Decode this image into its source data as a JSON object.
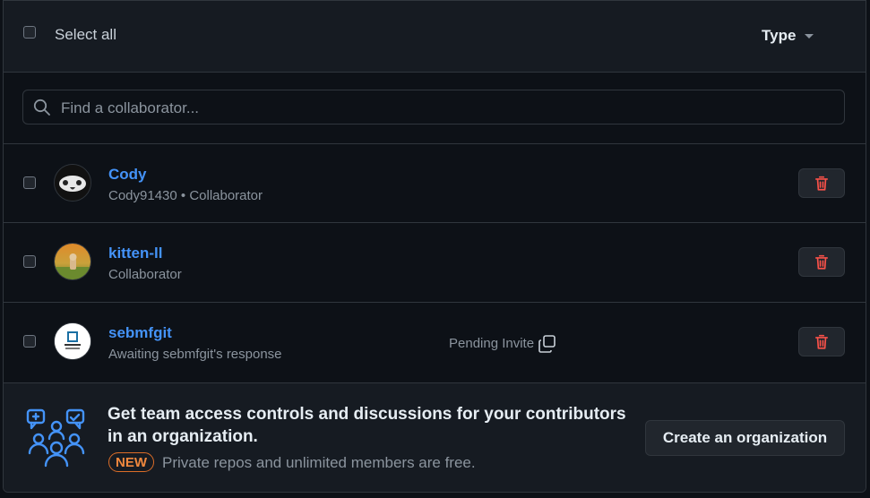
{
  "header": {
    "select_all_label": "Select all",
    "type_label": "Type"
  },
  "search": {
    "placeholder": "Find a collaborator..."
  },
  "collaborators": [
    {
      "name": "Cody",
      "subtitle": "Cody91430 • Collaborator"
    },
    {
      "name": "kitten-ll",
      "subtitle": "Collaborator"
    },
    {
      "name": "sebmfgit",
      "subtitle": "Awaiting sebmfgit's response",
      "status": "Pending Invite"
    }
  ],
  "promo": {
    "title": "Get team access controls and discussions for your contributors in an organization.",
    "badge": "NEW",
    "subtitle": "Private repos and unlimited members are free.",
    "button": "Create an organization"
  },
  "colors": {
    "link": "#4493f8",
    "danger": "#f85149",
    "badge": "#db6d28",
    "icon_accent": "#4493f8"
  }
}
